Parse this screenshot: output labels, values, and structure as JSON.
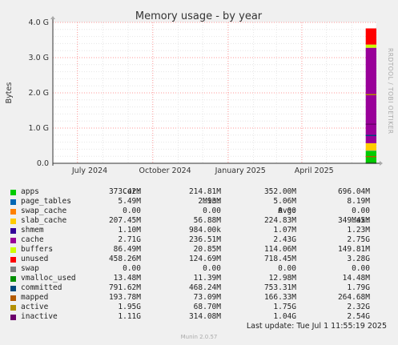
{
  "chart_data": {
    "type": "area",
    "title": "Memory usage - by year",
    "ylabel": "Bytes",
    "ylim": [
      0,
      4.0
    ],
    "y_unit": "G",
    "yticks": [
      "0.0",
      "1.0 G",
      "2.0 G",
      "3.0 G",
      "4.0 G"
    ],
    "ytick_values": [
      0,
      1,
      2,
      3,
      4
    ],
    "xticks": [
      "July 2024",
      "October 2024",
      "January 2025",
      "April 2025"
    ],
    "x_range": [
      "2024-06-01",
      "2025-07-01"
    ],
    "grid": true,
    "data_window": {
      "start": "2025-06-18",
      "end": "2025-07-01"
    },
    "stack_top_G": {
      "apps": 0.35,
      "page_tables": 0.36,
      "swap_cache": 0.36,
      "slab_cache": 0.57,
      "shmem": 0.57,
      "cache": 3.28,
      "buffers": 3.37,
      "unused": 3.83
    },
    "lines_G": {
      "committed": 0.79,
      "active": 1.95,
      "inactive": 1.11,
      "swap": 0.0,
      "vmalloc_used": 0.013,
      "mapped": 0.19
    }
  },
  "side_label": "RRDTOOL / TOBI OETIKER",
  "legend": {
    "headers": [
      "Cur:",
      "Min:",
      "Avg:",
      "Max:"
    ],
    "rows": [
      {
        "name": "apps",
        "color": "#00cc00",
        "cur": "373.42M",
        "min": "214.81M",
        "avg": "352.00M",
        "max": "696.04M"
      },
      {
        "name": "page_tables",
        "color": "#0066b3",
        "cur": "5.49M",
        "min": "2.93M",
        "avg": "5.06M",
        "max": "8.19M"
      },
      {
        "name": "swap_cache",
        "color": "#ff8000",
        "cur": "0.00",
        "min": "0.00",
        "avg": "0.00",
        "max": "0.00"
      },
      {
        "name": "slab_cache",
        "color": "#ffcc00",
        "cur": "207.45M",
        "min": "56.88M",
        "avg": "224.83M",
        "max": "349.45M"
      },
      {
        "name": "shmem",
        "color": "#330099",
        "cur": "1.10M",
        "min": "984.00k",
        "avg": "1.07M",
        "max": "1.23M"
      },
      {
        "name": "cache",
        "color": "#990099",
        "cur": "2.71G",
        "min": "236.51M",
        "avg": "2.43G",
        "max": "2.75G"
      },
      {
        "name": "buffers",
        "color": "#ccff00",
        "cur": "86.49M",
        "min": "20.85M",
        "avg": "114.06M",
        "max": "149.81M"
      },
      {
        "name": "unused",
        "color": "#ff0000",
        "cur": "458.26M",
        "min": "124.69M",
        "avg": "718.45M",
        "max": "3.28G"
      },
      {
        "name": "swap",
        "color": "#808080",
        "cur": "0.00",
        "min": "0.00",
        "avg": "0.00",
        "max": "0.00"
      },
      {
        "name": "vmalloc_used",
        "color": "#008f00",
        "cur": "13.48M",
        "min": "11.39M",
        "avg": "12.98M",
        "max": "14.48M"
      },
      {
        "name": "committed",
        "color": "#00487d",
        "cur": "791.62M",
        "min": "468.24M",
        "avg": "753.31M",
        "max": "1.79G"
      },
      {
        "name": "mapped",
        "color": "#b35a00",
        "cur": "193.78M",
        "min": "73.09M",
        "avg": "166.33M",
        "max": "264.68M"
      },
      {
        "name": "active",
        "color": "#b38f00",
        "cur": "1.95G",
        "min": "68.70M",
        "avg": "1.75G",
        "max": "2.32G"
      },
      {
        "name": "inactive",
        "color": "#6b006b",
        "cur": "1.11G",
        "min": "314.08M",
        "avg": "1.04G",
        "max": "2.54G"
      }
    ]
  },
  "last_update": "Last update: Tue Jul  1 11:55:19 2025",
  "footer": "Munin 2.0.57"
}
